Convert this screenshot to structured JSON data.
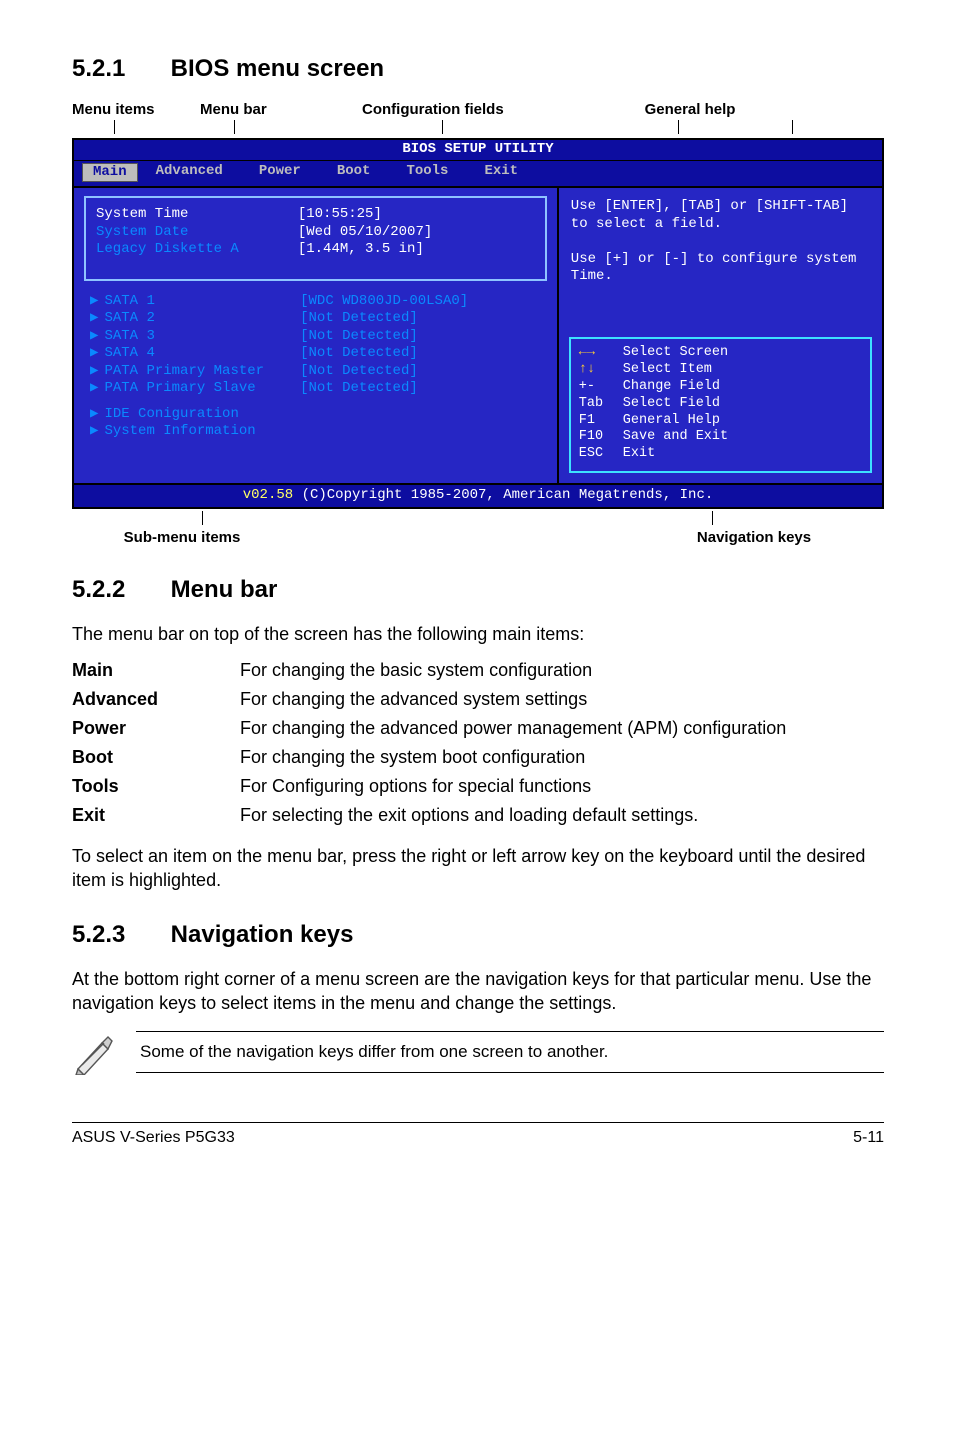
{
  "section521": {
    "num": "5.2.1",
    "title": "BIOS menu screen"
  },
  "diagram_labels": {
    "menu_items": "Menu items",
    "menu_bar": "Menu bar",
    "conf_fields": "Configuration fields",
    "general_help": "General help"
  },
  "bios": {
    "title": "BIOS SETUP UTILITY",
    "tabs": [
      "Main",
      "Advanced",
      "Power",
      "Boot",
      "Tools",
      "Exit"
    ],
    "active_tab_index": 0,
    "fields": {
      "system_time": {
        "label": "System Time",
        "value": "[10:55:25]"
      },
      "system_date": {
        "label": "System Date",
        "value": "[Wed 05/10/2007]"
      },
      "legacy_diskette": {
        "label": "Legacy Diskette A",
        "value": "[1.44M, 3.5 in]"
      }
    },
    "devices": [
      {
        "label": "SATA 1",
        "value": "[WDC WD800JD-00LSA0]"
      },
      {
        "label": "SATA 2",
        "value": "[Not Detected]"
      },
      {
        "label": "SATA 3",
        "value": "[Not Detected]"
      },
      {
        "label": "SATA 4",
        "value": "[Not Detected]"
      },
      {
        "label": "PATA Primary Master",
        "value": "[Not Detected]"
      },
      {
        "label": "PATA Primary Slave",
        "value": "[Not Detected]"
      }
    ],
    "submenus": [
      "IDE Coniguration",
      "System Information"
    ],
    "help_top": "Use [ENTER], [TAB] or [SHIFT-TAB] to select a field.\n\nUse [+] or [-] to configure system Time.",
    "nav_keys": [
      {
        "k": "←→",
        "d": "Select Screen",
        "iconColor": true
      },
      {
        "k": "↑↓",
        "d": "Select Item",
        "iconColor": true
      },
      {
        "k": "+-",
        "d": "Change Field"
      },
      {
        "k": "Tab",
        "d": "Select Field"
      },
      {
        "k": "F1",
        "d": "General Help"
      },
      {
        "k": "F10",
        "d": "Save and Exit"
      },
      {
        "k": "ESC",
        "d": "Exit"
      }
    ],
    "footer_version": "v02.58",
    "footer_text": "(C)Copyright 1985-2007, American Megatrends, Inc."
  },
  "below": {
    "submenu": "Sub-menu items",
    "navkeys": "Navigation keys"
  },
  "section522": {
    "num": "5.2.2",
    "title": "Menu bar",
    "intro": "The menu bar on top of the screen has the following main items:",
    "rows": [
      {
        "k": "Main",
        "v": "For changing the basic system configuration"
      },
      {
        "k": "Advanced",
        "v": "For changing the advanced system settings"
      },
      {
        "k": "Power",
        "v": "For changing the advanced power management (APM) configuration"
      },
      {
        "k": "Boot",
        "v": "For changing the system boot configuration"
      },
      {
        "k": "Tools",
        "v": "For Configuring options for special functions"
      },
      {
        "k": "Exit",
        "v": "For selecting the exit options and loading default settings."
      }
    ],
    "outro": "To select an item on the menu bar, press the right or left arrow key on the keyboard until the desired item is highlighted."
  },
  "section523": {
    "num": "5.2.3",
    "title": "Navigation keys",
    "body": "At the bottom right corner of a menu screen are the navigation keys for that particular menu. Use the navigation keys to select items in the menu and change the settings.",
    "note": "Some of the navigation keys differ from one screen to another."
  },
  "footer": {
    "left": "ASUS V-Series P5G33",
    "right": "5-11"
  }
}
